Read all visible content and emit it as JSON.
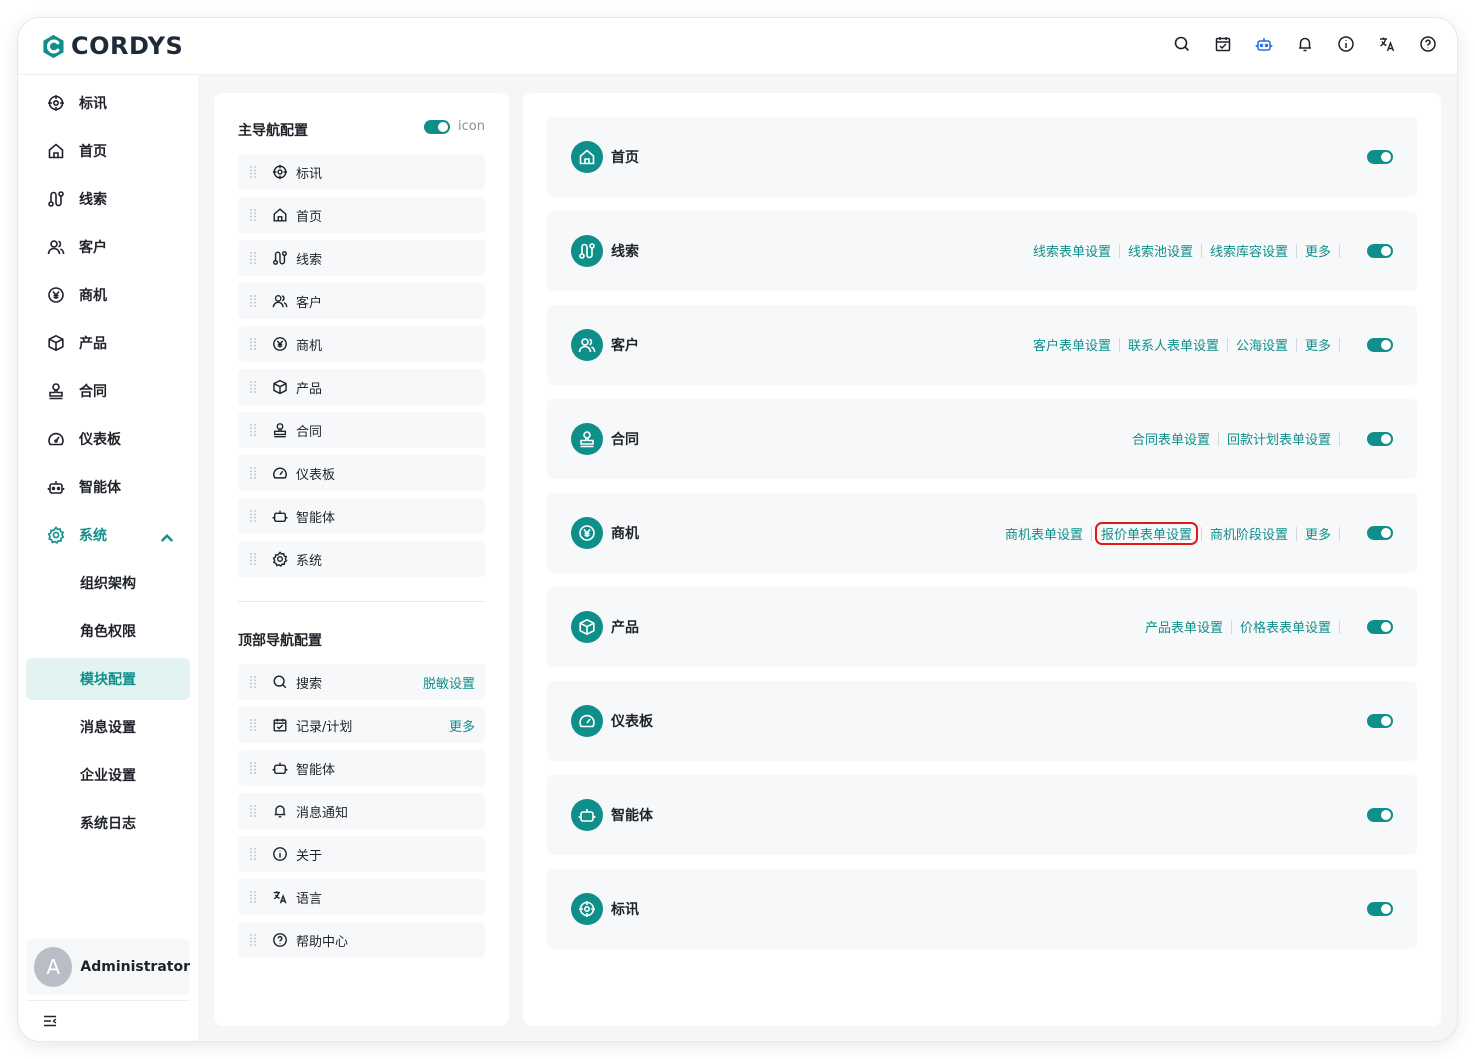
{
  "app": {
    "logo_text": "CORDYS",
    "brand_color": "#0f8f8a"
  },
  "header": {
    "icons": [
      "search-icon",
      "calendar-icon",
      "robot-icon",
      "bell-icon",
      "info-icon",
      "translate-icon",
      "help-icon"
    ]
  },
  "sidebar": {
    "items": [
      {
        "label": "标讯",
        "icon": "target-icon"
      },
      {
        "label": "首页",
        "icon": "home-icon"
      },
      {
        "label": "线索",
        "icon": "route-icon"
      },
      {
        "label": "客户",
        "icon": "users-icon"
      },
      {
        "label": "商机",
        "icon": "yen-icon"
      },
      {
        "label": "产品",
        "icon": "box-icon"
      },
      {
        "label": "合同",
        "icon": "stamp-icon"
      },
      {
        "label": "仪表板",
        "icon": "gauge-icon"
      },
      {
        "label": "智能体",
        "icon": "robot-icon"
      },
      {
        "label": "系统",
        "icon": "gear-icon"
      }
    ],
    "sub_items": [
      "组织架构",
      "角色权限",
      "模块配置",
      "消息设置",
      "企业设置",
      "系统日志"
    ],
    "selected_sub": "模块配置",
    "user": {
      "avatar_letter": "A",
      "name": "Administrator"
    }
  },
  "main_nav": {
    "title": "主导航配置",
    "icon_toggle_label": "icon",
    "rows": [
      "标讯",
      "首页",
      "线索",
      "客户",
      "商机",
      "产品",
      "合同",
      "仪表板",
      "智能体",
      "系统"
    ]
  },
  "top_nav": {
    "title": "顶部导航配置",
    "rows": [
      {
        "label": "搜索",
        "icon": "search-icon",
        "link": "脱敏设置"
      },
      {
        "label": "记录/计划",
        "icon": "calendar-icon",
        "link": "更多"
      },
      {
        "label": "智能体",
        "icon": "robot-icon",
        "link": ""
      },
      {
        "label": "消息通知",
        "icon": "bell-icon",
        "link": ""
      },
      {
        "label": "关于",
        "icon": "info-icon",
        "link": ""
      },
      {
        "label": "语言",
        "icon": "translate-icon",
        "link": ""
      },
      {
        "label": "帮助中心",
        "icon": "help-icon",
        "link": ""
      }
    ]
  },
  "modules": [
    {
      "title": "首页",
      "links": []
    },
    {
      "title": "线索",
      "links": [
        "线索表单设置",
        "线索池设置",
        "线索库容设置",
        "更多"
      ]
    },
    {
      "title": "客户",
      "links": [
        "客户表单设置",
        "联系人表单设置",
        "公海设置",
        "更多"
      ]
    },
    {
      "title": "合同",
      "links": [
        "合同表单设置",
        "回款计划表单设置"
      ]
    },
    {
      "title": "商机",
      "links": [
        "商机表单设置",
        "报价单表单设置",
        "商机阶段设置",
        "更多"
      ]
    },
    {
      "title": "产品",
      "links": [
        "产品表单设置",
        "价格表表单设置"
      ]
    },
    {
      "title": "仪表板",
      "links": []
    },
    {
      "title": "智能体",
      "links": []
    },
    {
      "title": "标讯",
      "links": []
    }
  ]
}
